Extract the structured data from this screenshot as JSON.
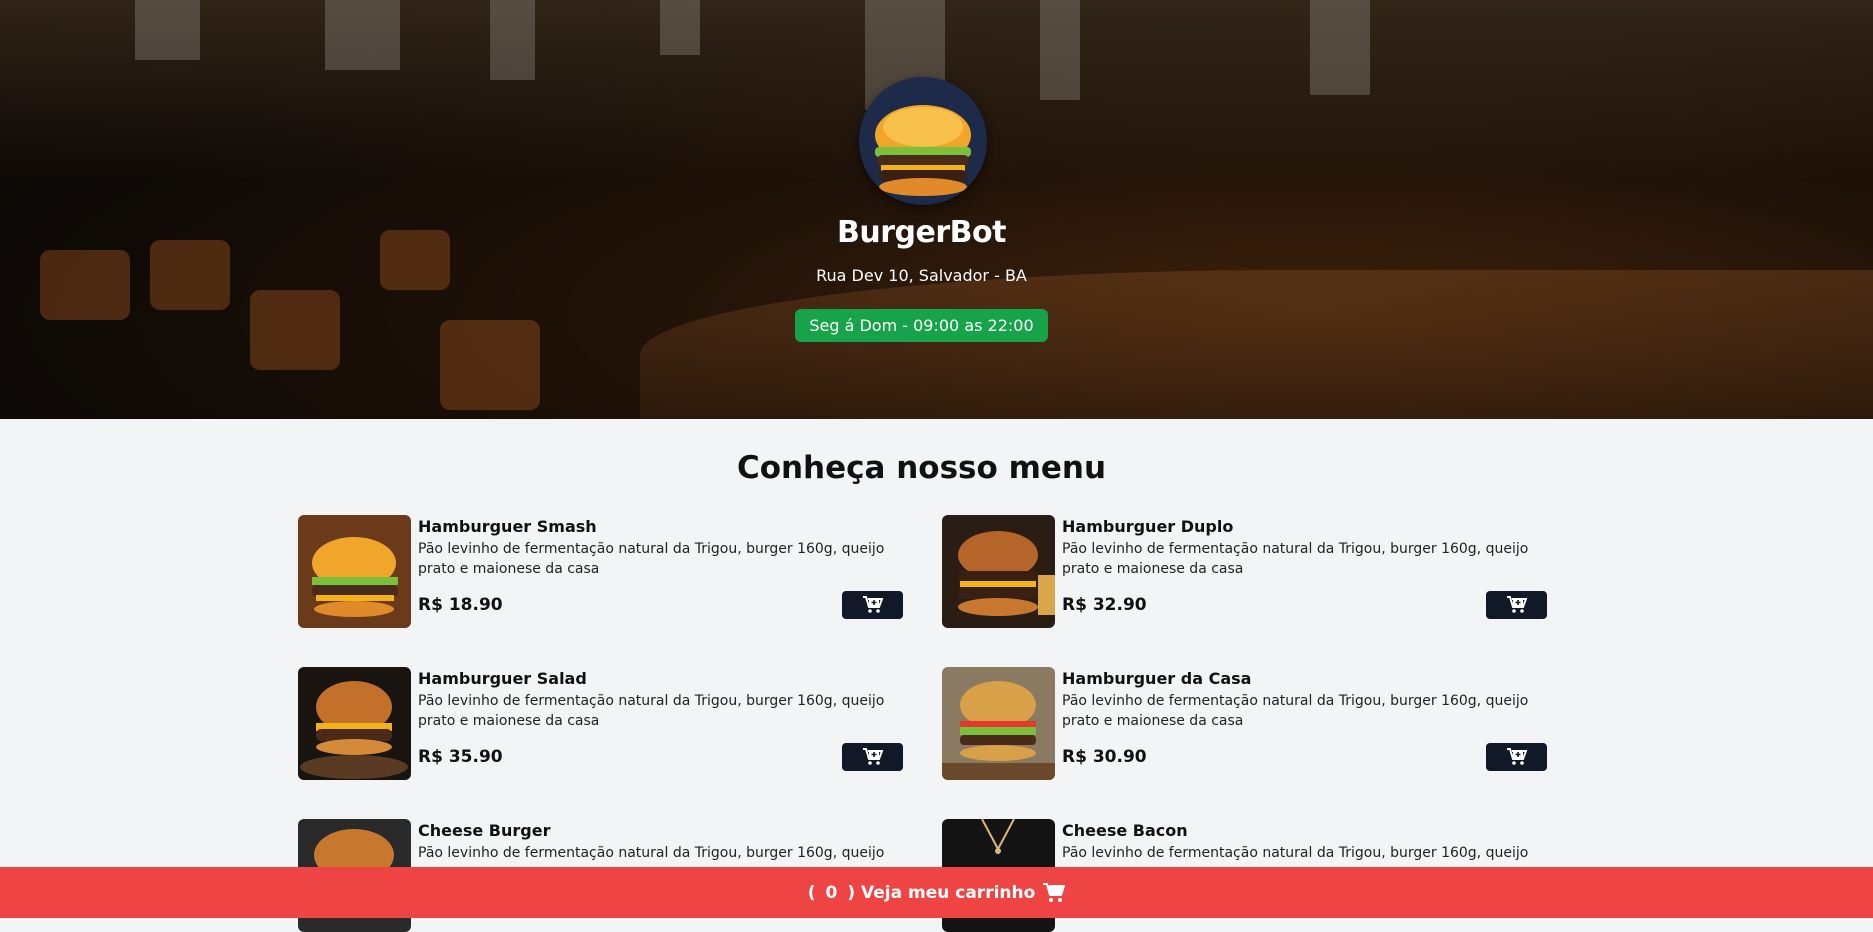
{
  "restaurant": {
    "name": "BurgerBot",
    "address": "Rua Dev 10, Salvador - BA",
    "hours": "Seg á Dom - 09:00 as 22:00",
    "hours_color": "#16a34a"
  },
  "menu": {
    "title": "Conheça nosso menu",
    "items": [
      {
        "name": "Hamburguer Smash",
        "description": "Pão levinho de fermentação natural da Trigou, burger 160g, queijo prato e maionese da casa",
        "price": "R$ 18.90",
        "image": "burger-photo"
      },
      {
        "name": "Hamburguer Duplo",
        "description": "Pão levinho de fermentação natural da Trigou, burger 160g, queijo prato e maionese da casa",
        "price": "R$ 32.90",
        "image": "burger-photo"
      },
      {
        "name": "Hamburguer Salad",
        "description": "Pão levinho de fermentação natural da Trigou, burger 160g, queijo prato e maionese da casa",
        "price": "R$ 35.90",
        "image": "burger-photo"
      },
      {
        "name": "Hamburguer da Casa",
        "description": "Pão levinho de fermentação natural da Trigou, burger 160g, queijo prato e maionese da casa",
        "price": "R$ 30.90",
        "image": "burger-photo"
      },
      {
        "name": "Cheese Burger",
        "description": "Pão levinho de fermentação natural da Trigou, burger 160g, queijo",
        "price": "",
        "image": "burger-photo"
      },
      {
        "name": "Cheese Bacon",
        "description": "Pão levinho de fermentação natural da Trigou, burger 160g, queijo",
        "price": "",
        "image": "burger-photo"
      }
    ],
    "add_button_icon": "cart-plus-icon"
  },
  "footer": {
    "open_paren": "(",
    "count": "0",
    "label": ") Veja meu carrinho",
    "icon": "cart-icon",
    "color": "#ef4444"
  },
  "colors": {
    "button_dark": "#111827",
    "background": "#f3f4f6"
  }
}
